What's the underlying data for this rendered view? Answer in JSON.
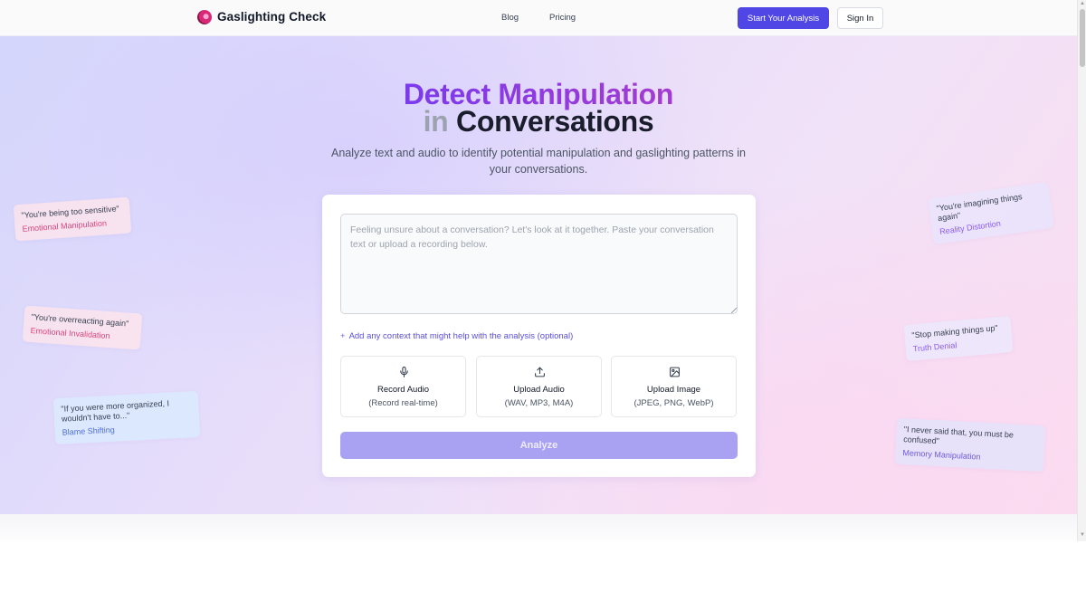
{
  "nav": {
    "brand": "Gaslighting Check",
    "links": [
      "Blog",
      "Pricing"
    ],
    "cta": "Start Your Analysis",
    "signin": "Sign In"
  },
  "hero": {
    "title_line1": "Detect Manipulation",
    "title_in": "in",
    "title_line2": "Conversations",
    "subtitle": "Analyze text and audio to identify potential manipulation and gaslighting patterns in your conversations."
  },
  "card": {
    "placeholder": "Feeling unsure about a conversation? Let's look at it together. Paste your conversation text or upload a recording below.",
    "context_link": "Add any context that might help with the analysis (optional)",
    "options": [
      {
        "label": "Record Audio",
        "sub": "(Record real-time)",
        "icon": "microphone-icon"
      },
      {
        "label": "Upload Audio",
        "sub": "(WAV, MP3, M4A)",
        "icon": "upload-icon"
      },
      {
        "label": "Upload Image",
        "sub": "(JPEG, PNG, WebP)",
        "icon": "image-icon"
      }
    ],
    "analyze": "Analyze"
  },
  "notes": [
    {
      "quote": "\"You're being too sensitive\"",
      "tag": "Emotional Manipulation",
      "color": "#d9467d"
    },
    {
      "quote": "\"You're overreacting again\"",
      "tag": "Emotional Invalidation",
      "color": "#d9467d"
    },
    {
      "quote": "\"If you were more organized, I wouldn't have to...\"",
      "tag": "Blame Shifting",
      "color": "#4f6fd6"
    },
    {
      "quote": "\"You're imagining things again\"",
      "tag": "Reality Distortion",
      "color": "#8b5cf6"
    },
    {
      "quote": "\"Stop making things up\"",
      "tag": "Truth Denial",
      "color": "#8b5cf6"
    },
    {
      "quote": "\"I never said that, you must be confused\"",
      "tag": "Memory Manipulation",
      "color": "#6d5bd8"
    }
  ],
  "colors": {
    "accent": "#5046e5",
    "title_gradient_start": "#7c3aed",
    "title_gradient_end": "#a43bd1",
    "analyze_disabled": "#a9a2f3"
  }
}
